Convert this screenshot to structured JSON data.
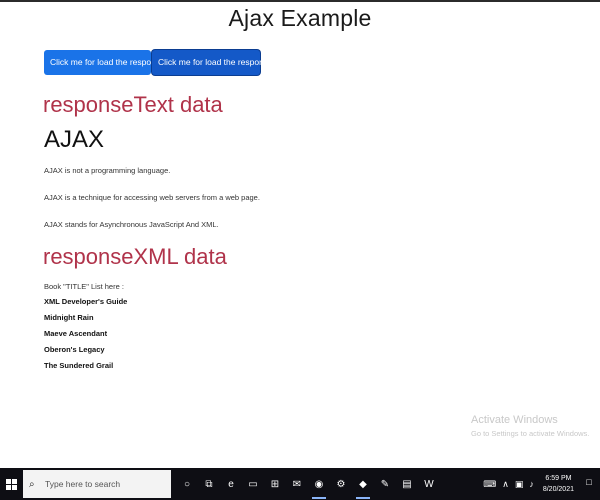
{
  "page": {
    "title": "Ajax Example"
  },
  "buttons": {
    "load_text": "Click me for load the responseText",
    "load_xml": "Click me for load the responseXML"
  },
  "response_text": {
    "heading": "responseText data",
    "title": "AJAX",
    "paragraphs": [
      "AJAX is not a programming language.",
      "AJAX is a technique for accessing web servers from a web page.",
      "AJAX stands for Asynchronous JavaScript And XML."
    ]
  },
  "response_xml": {
    "heading": "responseXML data",
    "list_label": "Book \"TITLE\" List here :",
    "titles": [
      "XML Developer's Guide",
      "Midnight Rain",
      "Maeve Ascendant",
      "Oberon's Legacy",
      "The Sundered Grail"
    ]
  },
  "watermark": {
    "title": "Activate Windows",
    "subtitle": "Go to Settings to activate Windows."
  },
  "taskbar": {
    "search_placeholder": "Type here to search",
    "search_icon": "search-icon",
    "pinned_icons": [
      {
        "name": "cortana-icon",
        "glyph": "○"
      },
      {
        "name": "task-view-icon",
        "glyph": "⧉"
      },
      {
        "name": "edge-icon",
        "glyph": "e"
      },
      {
        "name": "file-explorer-icon",
        "glyph": "▭"
      },
      {
        "name": "store-icon",
        "glyph": "⊞"
      },
      {
        "name": "mail-icon",
        "glyph": "✉"
      },
      {
        "name": "chrome-icon",
        "glyph": "◉"
      },
      {
        "name": "settings-icon",
        "glyph": "⚙"
      },
      {
        "name": "visual-studio-icon",
        "glyph": "◆"
      },
      {
        "name": "paint-icon",
        "glyph": "✎"
      },
      {
        "name": "notepad-icon",
        "glyph": "▤"
      },
      {
        "name": "word-icon",
        "glyph": "W"
      }
    ],
    "tray": {
      "time": "6:59 PM",
      "date": "8/20/2021"
    }
  }
}
